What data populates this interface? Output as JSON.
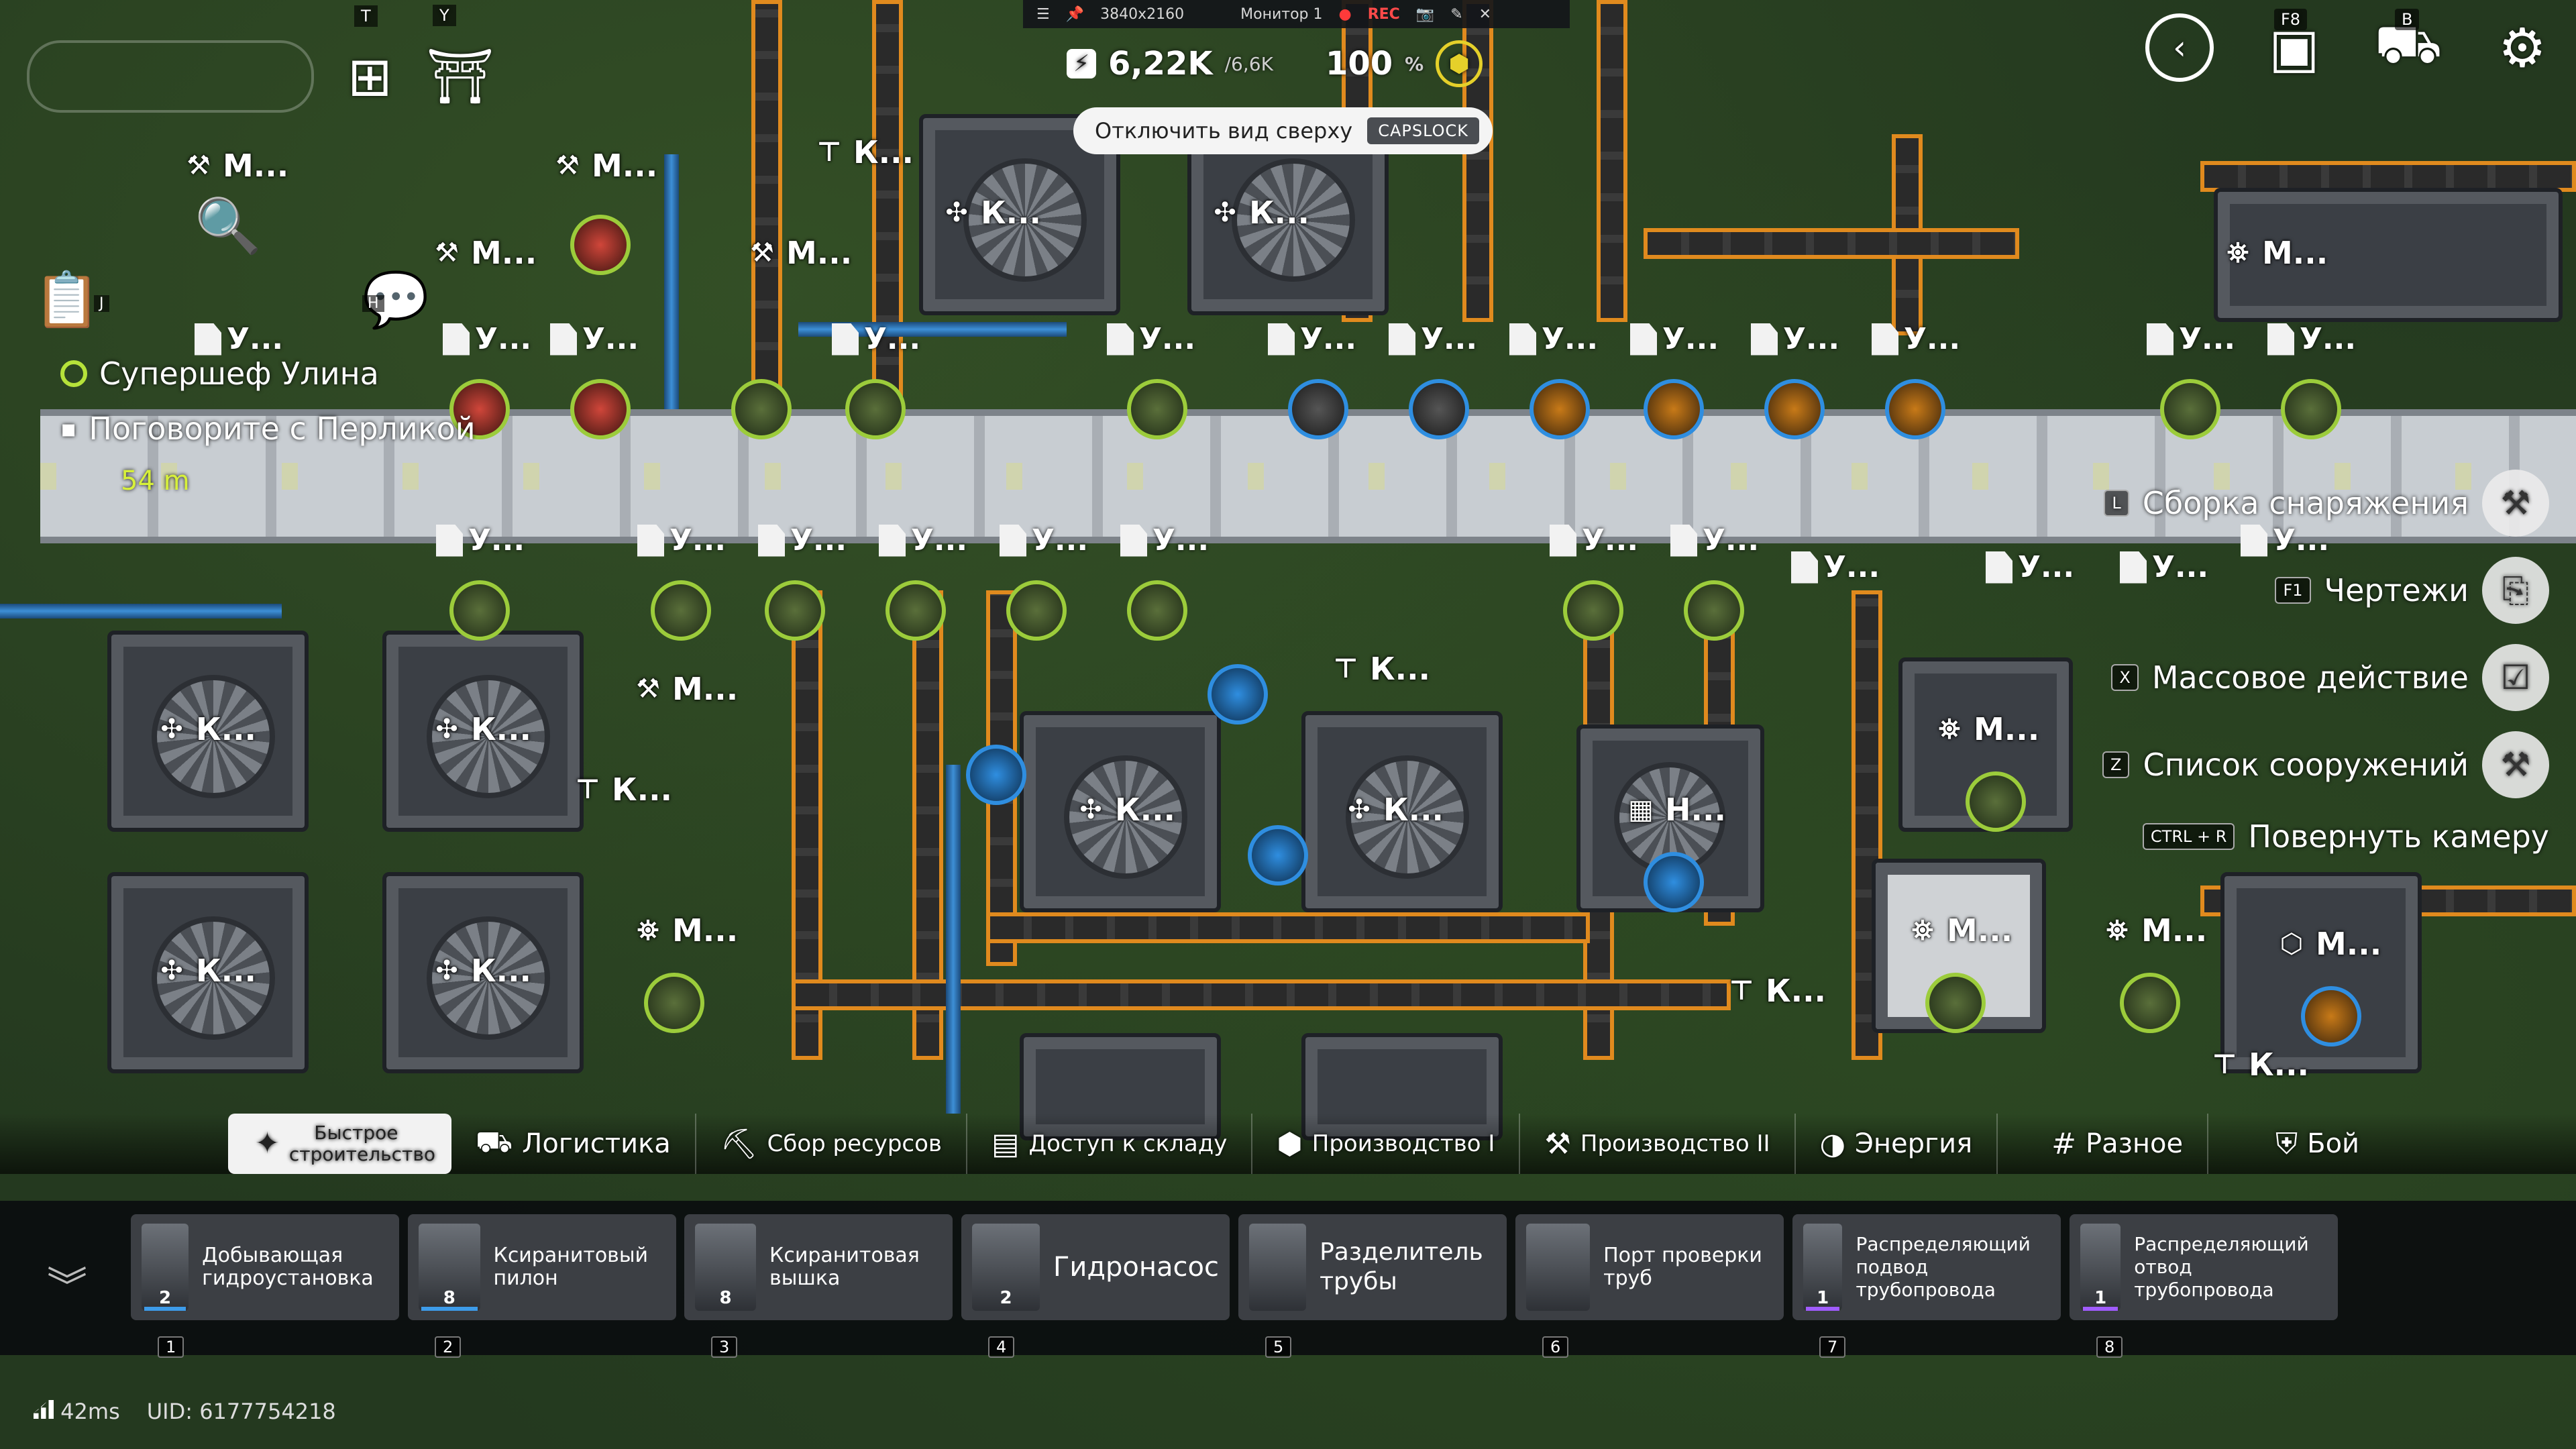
{
  "topbar": {
    "resolution": "3840x2160",
    "monitor": "Монитор 1",
    "rec": "REC"
  },
  "power": {
    "value": "6,22K",
    "capacity": "/6,6K",
    "percent": "100",
    "percent_sym": "%"
  },
  "view_toggle": {
    "label": "Отключить вид сверху",
    "key": "CAPSLOCK"
  },
  "quest": {
    "title": "Супершеф Улина",
    "task": "Поговорите с Перликой",
    "distance": "54 m"
  },
  "topright": {
    "key_f8": "F8",
    "key_b": "B"
  },
  "topleft": {
    "key_t": "T",
    "key_y": "Y",
    "key_j": "J",
    "key_h": "H"
  },
  "side_menu": [
    {
      "key": "L",
      "label": "Сборка снаряжения",
      "icon": "gear-assembly-icon"
    },
    {
      "key": "F1",
      "label": "Чертежи",
      "icon": "blueprint-icon"
    },
    {
      "key": "X",
      "label": "Массовое действие",
      "icon": "mass-action-icon"
    },
    {
      "key": "Z",
      "label": "Список сооружений",
      "icon": "building-list-icon"
    },
    {
      "key": "CTRL + R",
      "label": "Повернуть камеру",
      "icon": ""
    }
  ],
  "tabs": [
    {
      "label": "Быстрое строительство",
      "icon": "pin-icon"
    },
    {
      "label": "Логистика",
      "icon": "logistics-icon"
    },
    {
      "label": "Сбор ресурсов",
      "icon": "mining-icon"
    },
    {
      "label": "Доступ к складу",
      "icon": "storage-icon"
    },
    {
      "label": "Производство I",
      "icon": "production1-icon"
    },
    {
      "label": "Производство II",
      "icon": "production2-icon"
    },
    {
      "label": "Энергия",
      "icon": "energy-icon"
    },
    {
      "label": "Разное",
      "icon": "misc-icon"
    },
    {
      "label": "Бой",
      "icon": "combat-icon"
    }
  ],
  "hotbar": [
    {
      "num": "1",
      "name": "Добывающая гидроустановка",
      "count": "2"
    },
    {
      "num": "2",
      "name": "Ксиранитовый пилон",
      "count": "8"
    },
    {
      "num": "3",
      "name": "Ксиранитовая вышка",
      "count": "8"
    },
    {
      "num": "4",
      "name": "Гидронасос",
      "count": "2"
    },
    {
      "num": "5",
      "name": "Разделитель трубы",
      "count": ""
    },
    {
      "num": "6",
      "name": "Порт проверки труб",
      "count": ""
    },
    {
      "num": "7",
      "name": "Распределяющий подвод трубопровода",
      "count": "1"
    },
    {
      "num": "8",
      "name": "Распределяющий отвод трубопровода",
      "count": "1"
    }
  ],
  "status": {
    "ping": "42ms",
    "uid": "UID: 6177754218"
  },
  "map_labels": {
    "k": "К...",
    "m": "М...",
    "u": "У...",
    "n": "Н..."
  }
}
